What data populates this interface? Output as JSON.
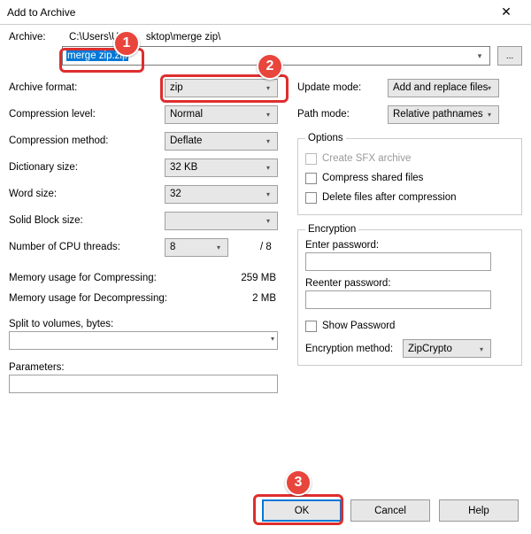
{
  "title": "Add to Archive",
  "archive": {
    "label": "Archive:",
    "path_prefix": "C:\\Users\\US",
    "path_suffix": "sktop\\merge zip\\",
    "filename_selected": "merge zip.zip",
    "browse_label": "..."
  },
  "left": {
    "archive_format": {
      "label": "Archive format:",
      "value": "zip"
    },
    "compression_level": {
      "label": "Compression level:",
      "value": "Normal"
    },
    "compression_method": {
      "label": "Compression method:",
      "value": "Deflate"
    },
    "dictionary_size": {
      "label": "Dictionary size:",
      "value": "32 KB"
    },
    "word_size": {
      "label": "Word size:",
      "value": "32"
    },
    "solid_block_size": {
      "label": "Solid Block size:",
      "value": ""
    },
    "cpu_threads": {
      "label": "Number of CPU threads:",
      "value": "8",
      "suffix": "/ 8"
    },
    "mem_compress": {
      "label": "Memory usage for Compressing:",
      "value": "259 MB"
    },
    "mem_decompress": {
      "label": "Memory usage for Decompressing:",
      "value": "2 MB"
    },
    "split_label": "Split to volumes, bytes:",
    "parameters_label": "Parameters:"
  },
  "right": {
    "update_mode": {
      "label": "Update mode:",
      "value": "Add and replace files"
    },
    "path_mode": {
      "label": "Path mode:",
      "value": "Relative pathnames"
    },
    "options_legend": "Options",
    "opt_sfx": "Create SFX archive",
    "opt_shared": "Compress shared files",
    "opt_delete": "Delete files after compression",
    "encryption_legend": "Encryption",
    "enter_pw": "Enter password:",
    "reenter_pw": "Reenter password:",
    "show_pw": "Show Password",
    "enc_method": {
      "label": "Encryption method:",
      "value": "ZipCrypto"
    }
  },
  "buttons": {
    "ok": "OK",
    "cancel": "Cancel",
    "help": "Help"
  },
  "annotations": {
    "one": "1",
    "two": "2",
    "three": "3"
  }
}
